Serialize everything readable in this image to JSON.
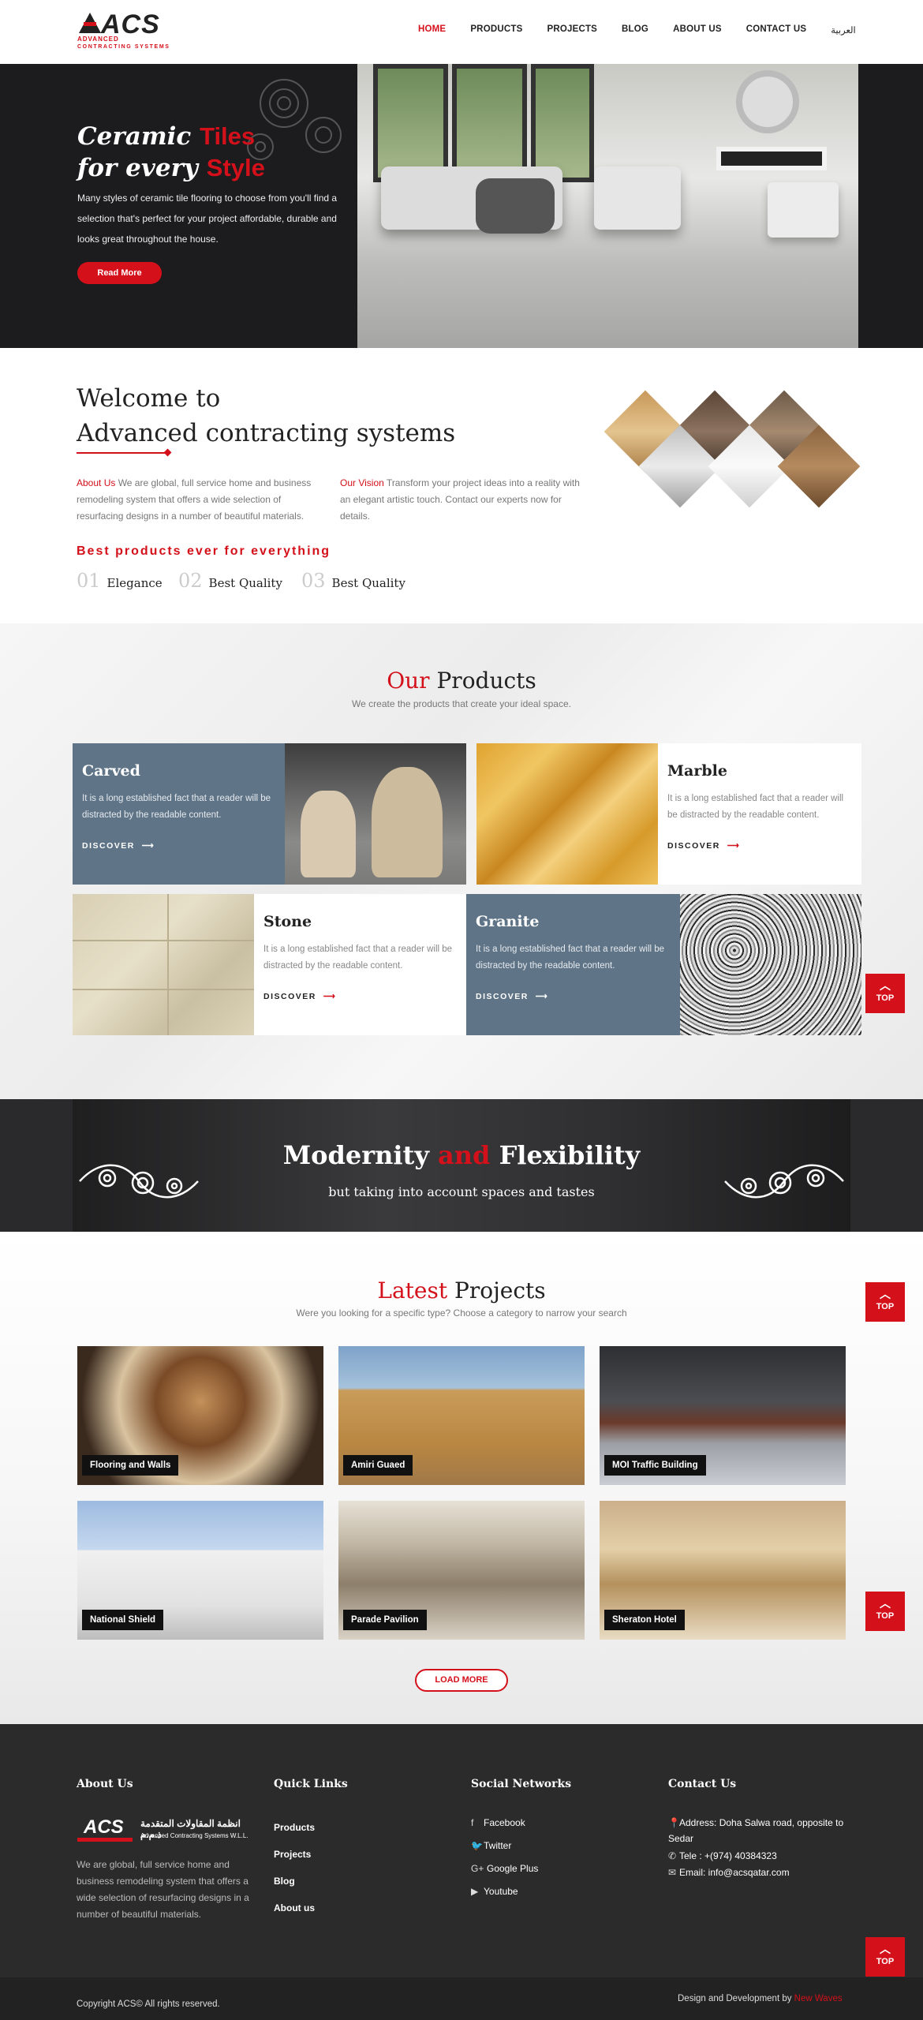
{
  "header": {
    "logo": {
      "text": "ACS",
      "line1": "ADVANCED",
      "line2": "CONTRACTING SYSTEMS"
    },
    "nav": [
      "HOME",
      "PRODUCTS",
      "PROJECTS",
      "BLOG",
      "ABOUT US",
      "CONTACT US",
      "العربية"
    ]
  },
  "hero": {
    "title_part1": "Ceramic ",
    "title_red1": "Tiles",
    "title_part2": "for every ",
    "title_red2": "Style",
    "description": "Many styles of ceramic tile flooring to choose from you'll find a selection that's perfect for your project affordable, durable and looks great throughout the house.",
    "button": "Read More"
  },
  "welcome": {
    "title_line1": "Welcome to",
    "title_line2": "Advanced contracting systems",
    "about_label": "About Us",
    "about_text": " We are global, full service home and business remodeling system that offers a wide selection of resurfacing designs in a number of beautiful materials.",
    "vision_label": "Our Vision",
    "vision_text": " Transform your project ideas into a reality with an elegant artistic touch. Contact our experts now for details.",
    "best_products": "Best products ever for everything",
    "features": [
      {
        "num": "01",
        "label": "Elegance"
      },
      {
        "num": "02",
        "label": "Best Quality"
      },
      {
        "num": "03",
        "label": "Best Quality"
      }
    ]
  },
  "products": {
    "title_red": "Our",
    "title_rest": " Products",
    "subtitle": "We create the products that create your ideal space.",
    "items": [
      {
        "name": "Carved",
        "text": "It is a long established fact that a reader will be distracted by the readable content.",
        "cta": "DISCOVER"
      },
      {
        "name": "Marble",
        "text": "It is a long established fact that a reader will be distracted by the readable content.",
        "cta": "DISCOVER"
      },
      {
        "name": "Stone",
        "text": "It is a long established fact that a reader will be distracted by the readable content.",
        "cta": "DISCOVER"
      },
      {
        "name": "Granite",
        "text": "It is a long established fact that a reader will be distracted by the readable content.",
        "cta": "DISCOVER"
      }
    ]
  },
  "modernity": {
    "title_part1": "Modernity ",
    "title_red": "and",
    "title_part2": " Flexibility",
    "subtitle": "but taking into account spaces and tastes"
  },
  "projects": {
    "title_red": "Latest",
    "title_rest": " Projects",
    "subtitle": "Were you looking for a specific type? Choose a category to narrow your search",
    "items": [
      "Flooring and Walls",
      "Amiri Guaed",
      "MOI Traffic Building",
      "National Shield",
      "Parade Pavilion",
      "Sheraton Hotel"
    ],
    "load_more": "LOAD MORE"
  },
  "top_button": "TOP",
  "footer": {
    "about_title": "About Us",
    "logo_arabic": "انظمة المقاولات المتقدمة ذ.م.م",
    "logo_english": "Advanced Contracting Systems W.L.L.",
    "about_text": "We are global, full service home and business remodeling system that offers a wide selection of resurfacing designs in a number of beautiful materials.",
    "links_title": "Quick Links",
    "links": [
      "Products",
      "Projects",
      "Blog",
      "About us"
    ],
    "social_title": "Social Networks",
    "social": [
      "Facebook",
      "Twitter",
      "Google Plus",
      "Youtube"
    ],
    "contact_title": "Contact Us",
    "address": "Address: Doha Salwa road, opposite to Sedar",
    "tele": "Tele : +(974) 40384323",
    "email": "Email: info@acsqatar.com",
    "copyright": "Copyright ACS© All rights reserved.",
    "design_by": "Design and Development by ",
    "design_company": "New Waves"
  }
}
